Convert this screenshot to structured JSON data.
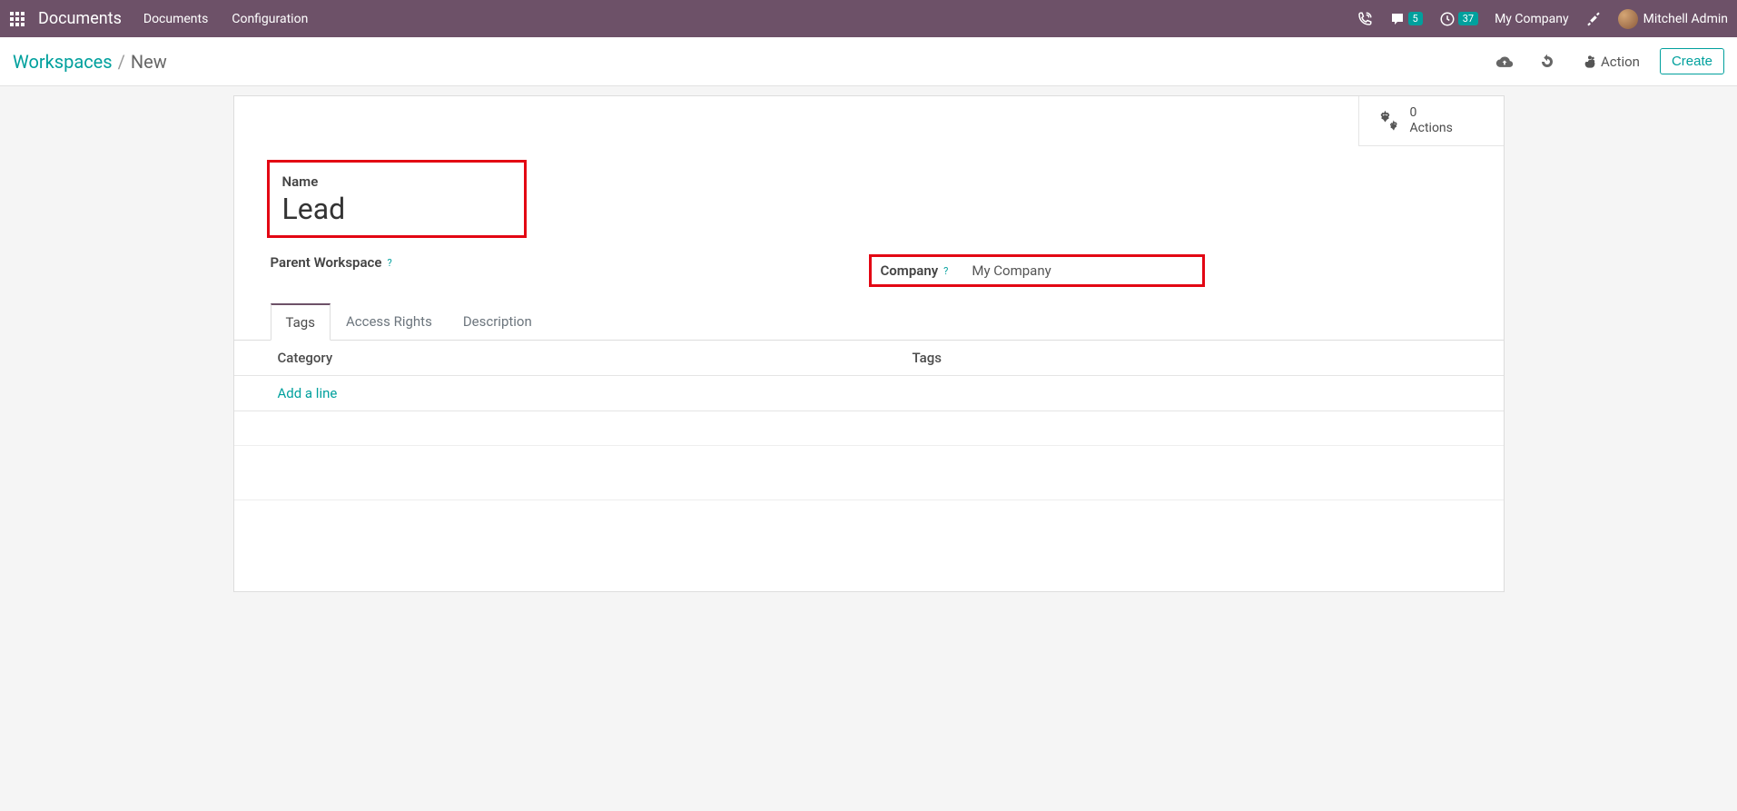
{
  "topbar": {
    "brand": "Documents",
    "nav": [
      "Documents",
      "Configuration"
    ],
    "messages_count": "5",
    "activities_count": "37",
    "company": "My Company",
    "user": "Mitchell Admin"
  },
  "breadcrumb": {
    "parent": "Workspaces",
    "current": "New"
  },
  "controls": {
    "action_label": "Action",
    "create_label": "Create"
  },
  "stat": {
    "count": "0",
    "label": "Actions"
  },
  "form": {
    "name_label": "Name",
    "name_value": "Lead",
    "parent_workspace_label": "Parent Workspace",
    "company_label": "Company",
    "company_value": "My Company"
  },
  "tabs": [
    "Tags",
    "Access Rights",
    "Description"
  ],
  "table": {
    "col1": "Category",
    "col2": "Tags",
    "add_line": "Add a line"
  }
}
